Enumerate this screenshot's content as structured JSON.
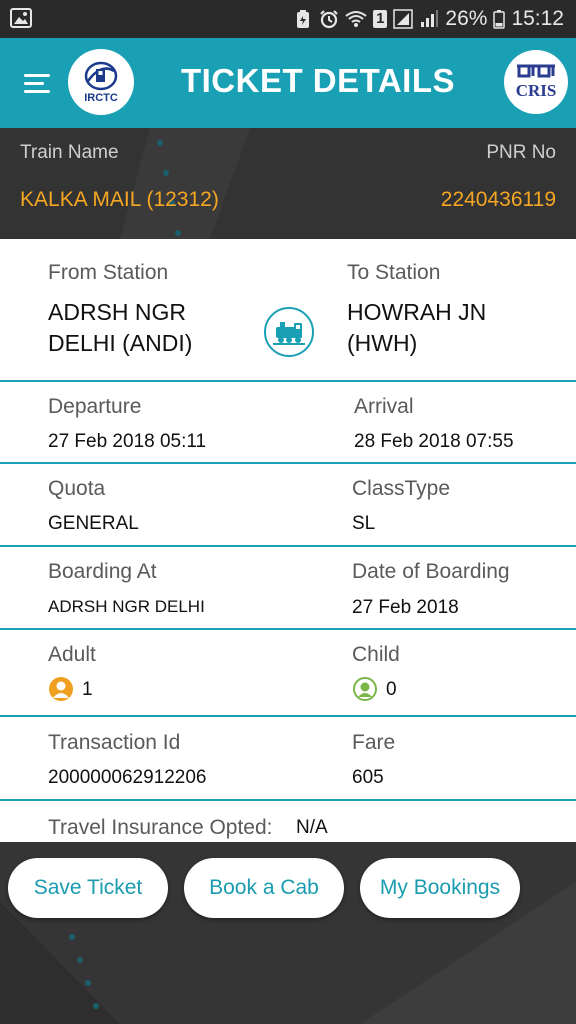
{
  "status_bar": {
    "battery_percent": "26%",
    "time": "15:12",
    "sim_badge": "1"
  },
  "app_bar": {
    "title": "TICKET DETAILS",
    "left_logo_text": "IRCTC",
    "right_logo_text": "CRIS",
    "accent_color": "#1aa0b5"
  },
  "train": {
    "name_label": "Train Name",
    "name_value": "KALKA MAIL (12312)",
    "pnr_label": "PNR No",
    "pnr_value": "2240436119",
    "value_color": "#f5a623"
  },
  "journey": {
    "from_label": "From Station",
    "from_line1": "ADRSH NGR",
    "from_line2": "DELHI (ANDI)",
    "to_label": "To Station",
    "to_line1": "HOWRAH JN",
    "to_line2": "(HWH)"
  },
  "times": {
    "departure_label": "Departure",
    "departure_value": "27 Feb 2018 05:11",
    "arrival_label": "Arrival",
    "arrival_value": "28 Feb 2018 07:55"
  },
  "quota": {
    "quota_label": "Quota",
    "quota_value": "GENERAL",
    "class_label": "ClassType",
    "class_value": "SL"
  },
  "boarding": {
    "boarding_label": "Boarding At",
    "boarding_value": "ADRSH NGR DELHI",
    "date_label": "Date of Boarding",
    "date_value": "27 Feb 2018"
  },
  "passengers": {
    "adult_label": "Adult",
    "adult_count": "1",
    "child_label": "Child",
    "child_count": "0"
  },
  "payment": {
    "txn_label": "Transaction Id",
    "txn_value": "200000062912206",
    "fare_label": "Fare",
    "fare_value": "605"
  },
  "insurance": {
    "label": "Travel Insurance Opted:",
    "value": "N/A"
  },
  "actions": {
    "save_ticket": "Save Ticket",
    "book_cab": "Book a Cab",
    "my_bookings": "My Bookings"
  }
}
